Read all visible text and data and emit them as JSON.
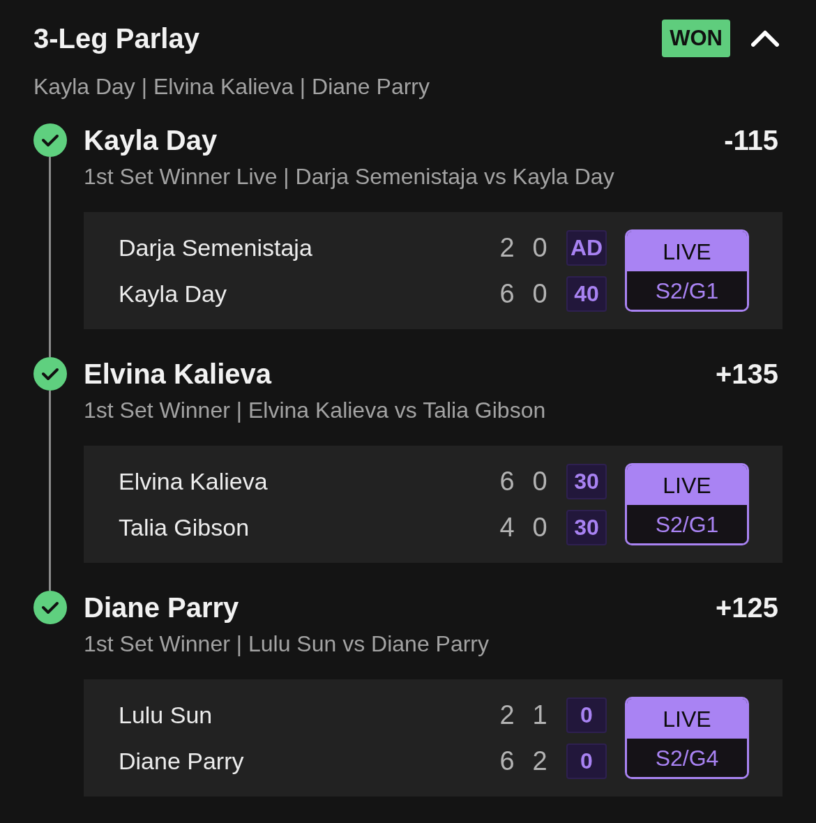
{
  "header": {
    "title": "3-Leg Parlay",
    "status": "WON",
    "expanded": true
  },
  "summary": "Kayla Day | Elvina Kalieva | Diane Parry",
  "legs": [
    {
      "won": true,
      "selection": "Kayla Day",
      "odds": "-115",
      "market": "1st Set Winner Live | Darja Semenistaja vs Kayla Day",
      "players": [
        {
          "name": "Darja Semenistaja",
          "sets": [
            "2",
            "0"
          ],
          "game": "AD"
        },
        {
          "name": "Kayla Day",
          "sets": [
            "6",
            "0"
          ],
          "game": "40"
        }
      ],
      "live": {
        "label": "LIVE",
        "period": "S2/G1"
      }
    },
    {
      "won": true,
      "selection": "Elvina Kalieva",
      "odds": "+135",
      "market": "1st Set Winner | Elvina Kalieva vs Talia Gibson",
      "players": [
        {
          "name": "Elvina Kalieva",
          "sets": [
            "6",
            "0"
          ],
          "game": "30"
        },
        {
          "name": "Talia Gibson",
          "sets": [
            "4",
            "0"
          ],
          "game": "30"
        }
      ],
      "live": {
        "label": "LIVE",
        "period": "S2/G1"
      }
    },
    {
      "won": true,
      "selection": "Diane Parry",
      "odds": "+125",
      "market": "1st Set Winner | Lulu Sun vs Diane Parry",
      "players": [
        {
          "name": "Lulu Sun",
          "sets": [
            "2",
            "1"
          ],
          "game": "0"
        },
        {
          "name": "Diane Parry",
          "sets": [
            "6",
            "2"
          ],
          "game": "0"
        }
      ],
      "live": {
        "label": "LIVE",
        "period": "S2/G4"
      }
    }
  ]
}
